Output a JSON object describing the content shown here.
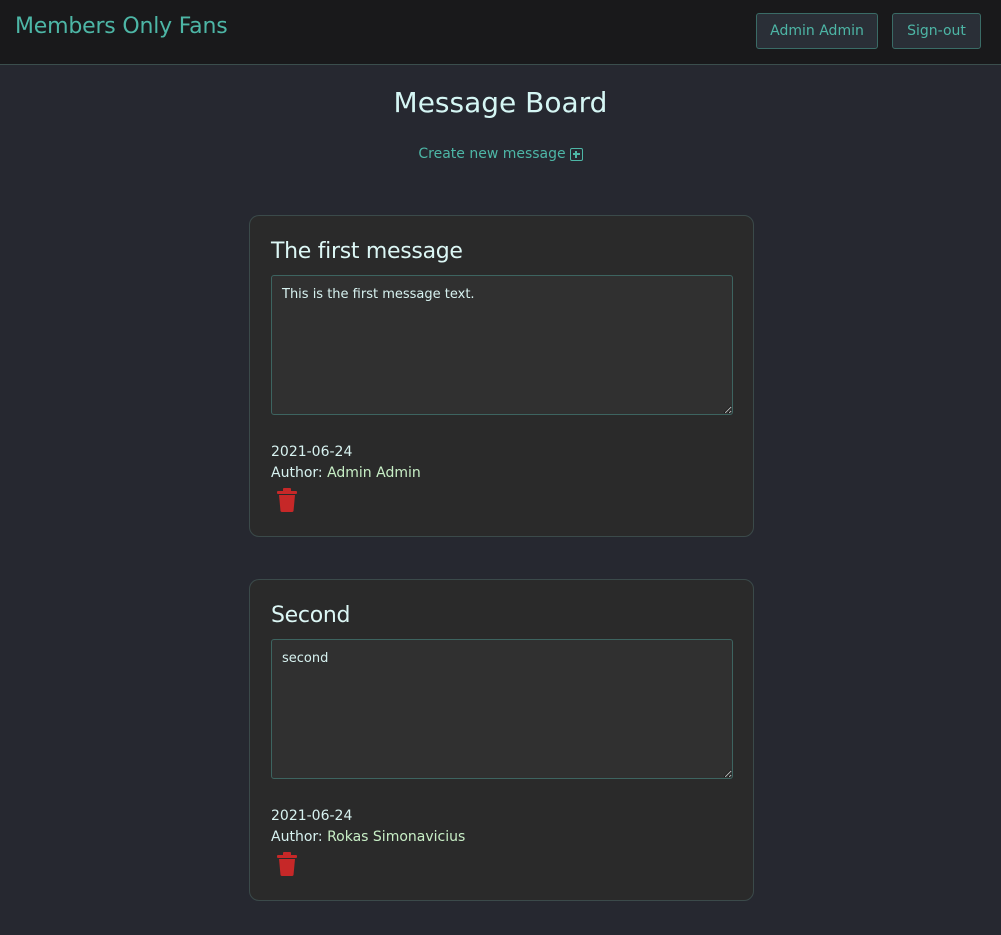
{
  "navbar": {
    "brand": "Members Only Fans",
    "user_button": "Admin Admin",
    "signout_button": "Sign-out"
  },
  "main": {
    "title": "Message Board",
    "create_link": "Create new message"
  },
  "messages": [
    {
      "title": "The first message",
      "body": "This is the first message text.",
      "date": "2021-06-24",
      "author_label": "Author:",
      "author": "Admin Admin"
    },
    {
      "title": "Second",
      "body": "second",
      "date": "2021-06-24",
      "author_label": "Author:",
      "author": "Rokas Simonavicius"
    }
  ],
  "icons": {
    "create": "plus-square-icon",
    "delete": "trash-icon"
  },
  "colors": {
    "background": "#262830",
    "navbar": "#19191b",
    "accent": "#4db6a6",
    "card": "#2a2a2a",
    "delete": "#c62828"
  }
}
